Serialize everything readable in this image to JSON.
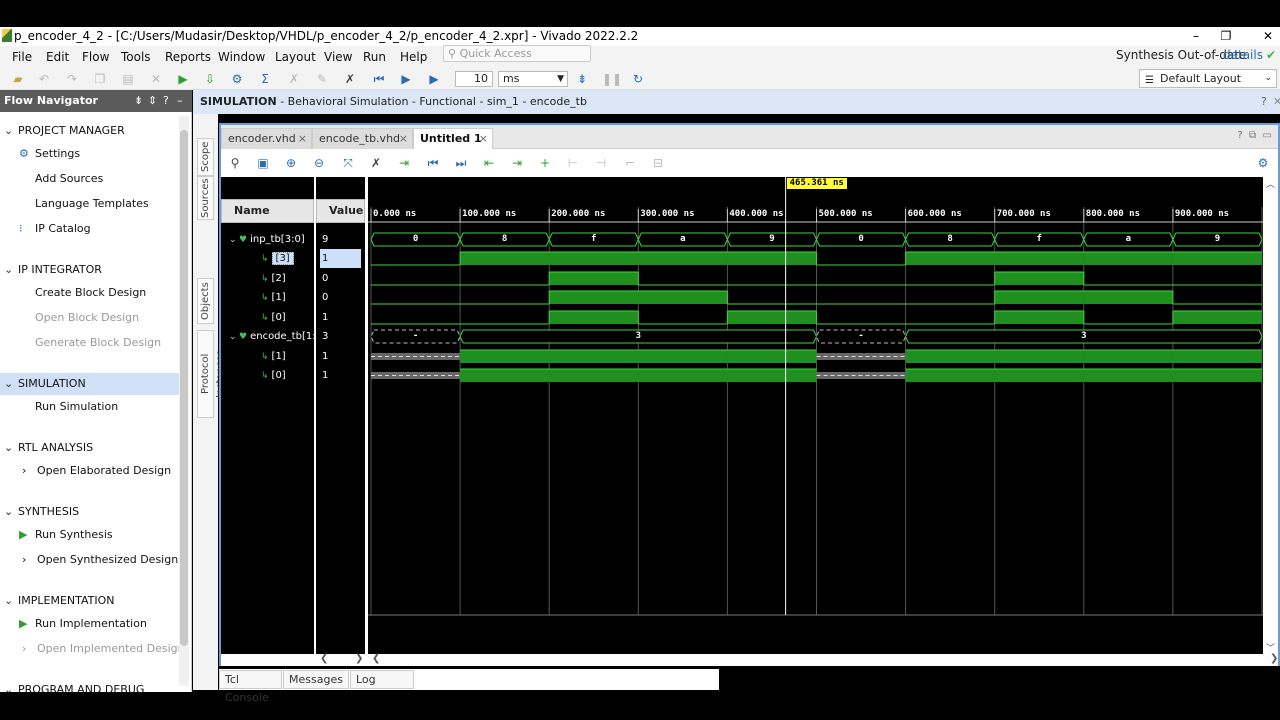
{
  "window": {
    "title": "p_encoder_4_2 - [C:/Users/Mudasir/Desktop/VHDL/p_encoder_4_2/p_encoder_4_2.xpr] - Vivado 2022.2.2"
  },
  "menu": [
    "File",
    "Edit",
    "Flow",
    "Tools",
    "Reports",
    "Window",
    "Layout",
    "View",
    "Run",
    "Help"
  ],
  "quick_access": {
    "placeholder": "Quick Access"
  },
  "status": {
    "synthesis": "Synthesis Out-of-date",
    "details": "details"
  },
  "toolbar": {
    "run_value": "10",
    "run_unit": "ms",
    "layout": "Default Layout"
  },
  "flow_navigator": {
    "title": "Flow Navigator",
    "sections": [
      {
        "label": "PROJECT MANAGER",
        "expanded": true,
        "items": [
          {
            "label": "Settings",
            "icon": "gear-icon"
          },
          {
            "label": "Add Sources"
          },
          {
            "label": "Language Templates"
          },
          {
            "label": "IP Catalog",
            "icon": "ip-icon"
          }
        ]
      },
      {
        "label": "IP INTEGRATOR",
        "expanded": true,
        "items": [
          {
            "label": "Create Block Design"
          },
          {
            "label": "Open Block Design",
            "dim": true
          },
          {
            "label": "Generate Block Design",
            "dim": true
          }
        ]
      },
      {
        "label": "SIMULATION",
        "expanded": true,
        "selected": true,
        "items": [
          {
            "label": "Run Simulation"
          }
        ]
      },
      {
        "label": "RTL ANALYSIS",
        "expanded": true,
        "items": [
          {
            "label": "Open Elaborated Design",
            "expander": true
          }
        ]
      },
      {
        "label": "SYNTHESIS",
        "expanded": true,
        "items": [
          {
            "label": "Run Synthesis",
            "icon": "play-icon"
          },
          {
            "label": "Open Synthesized Design",
            "expander": true
          }
        ]
      },
      {
        "label": "IMPLEMENTATION",
        "expanded": true,
        "items": [
          {
            "label": "Run Implementation",
            "icon": "play-icon"
          },
          {
            "label": "Open Implemented Design",
            "expander": true,
            "dim": true
          }
        ]
      },
      {
        "label": "PROGRAM AND DEBUG",
        "expanded": true,
        "items": []
      }
    ]
  },
  "sim_header": {
    "bold": "SIMULATION",
    "rest": " - Behavioral Simulation - Functional - sim_1 - encode_tb"
  },
  "side_tabs": [
    "Scope",
    "Sources",
    "Objects",
    "Protocol Instances"
  ],
  "editor_tabs": [
    {
      "label": "encoder.vhd",
      "active": false
    },
    {
      "label": "encode_tb.vhd",
      "active": false
    },
    {
      "label": "Untitled 1",
      "active": true
    }
  ],
  "wave": {
    "name_header": "Name",
    "value_header": "Value",
    "cursor": "465.361 ns",
    "cursor_ns": 465.361,
    "time_range_ns": [
      0,
      1000
    ],
    "ticks": [
      "0.000 ns",
      "100.000 ns",
      "200.000 ns",
      "300.000 ns",
      "400.000 ns",
      "500.000 ns",
      "600.000 ns",
      "700.000 ns",
      "800.000 ns",
      "900.000 ns"
    ],
    "signals": [
      {
        "name": "inp_tb[3:0]",
        "value": "9",
        "bus": true,
        "expanded": true,
        "segments": [
          {
            "t0": 0,
            "t1": 100,
            "v": "0"
          },
          {
            "t0": 100,
            "t1": 200,
            "v": "8"
          },
          {
            "t0": 200,
            "t1": 300,
            "v": "f"
          },
          {
            "t0": 300,
            "t1": 400,
            "v": "a"
          },
          {
            "t0": 400,
            "t1": 500,
            "v": "9"
          },
          {
            "t0": 500,
            "t1": 600,
            "v": "0"
          },
          {
            "t0": 600,
            "t1": 700,
            "v": "8"
          },
          {
            "t0": 700,
            "t1": 800,
            "v": "f"
          },
          {
            "t0": 800,
            "t1": 900,
            "v": "a"
          },
          {
            "t0": 900,
            "t1": 1000,
            "v": "9"
          }
        ]
      },
      {
        "name": "[3]",
        "value": "1",
        "bit": true,
        "selected": true,
        "levels": [
          0,
          1,
          1,
          1,
          1,
          0,
          1,
          1,
          1,
          1
        ]
      },
      {
        "name": "[2]",
        "value": "0",
        "bit": true,
        "levels": [
          0,
          0,
          1,
          0,
          0,
          0,
          0,
          1,
          0,
          0
        ]
      },
      {
        "name": "[1]",
        "value": "0",
        "bit": true,
        "levels": [
          0,
          0,
          1,
          1,
          0,
          0,
          0,
          1,
          1,
          0
        ]
      },
      {
        "name": "[0]",
        "value": "1",
        "bit": true,
        "levels": [
          0,
          0,
          1,
          0,
          1,
          0,
          0,
          1,
          0,
          1
        ]
      },
      {
        "name": "encode_tb[1:0]",
        "value": "3",
        "bus": true,
        "expanded": true,
        "segments": [
          {
            "t0": 0,
            "t1": 100,
            "v": "-"
          },
          {
            "t0": 100,
            "t1": 500,
            "v": "3"
          },
          {
            "t0": 500,
            "t1": 600,
            "v": "-"
          },
          {
            "t0": 600,
            "t1": 1000,
            "v": "3"
          }
        ]
      },
      {
        "name": "[1]",
        "value": "1",
        "bit": true,
        "levels": [
          "x",
          1,
          1,
          1,
          1,
          "x",
          1,
          1,
          1,
          1
        ]
      },
      {
        "name": "[0]",
        "value": "1",
        "bit": true,
        "levels": [
          "x",
          1,
          1,
          1,
          1,
          "x",
          1,
          1,
          1,
          1
        ]
      }
    ]
  },
  "bottom_tabs": [
    "Tcl Console",
    "Messages",
    "Log"
  ],
  "colors": {
    "wave_green": "#1f8f1f",
    "wave_line": "#3fd23f",
    "cursor_label": "#ffff33",
    "panel_selected": "#cfe0f7",
    "sim_header": "#dbe7f7"
  }
}
